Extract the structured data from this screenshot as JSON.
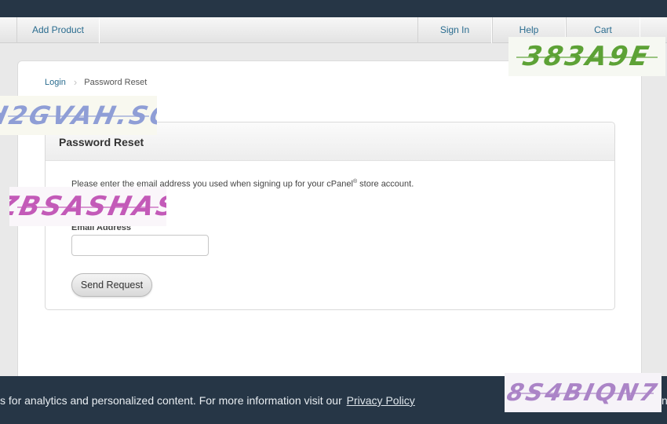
{
  "nav": {
    "items": [
      "Add Product",
      "Sign In",
      "Help",
      "Cart"
    ]
  },
  "breadcrumb": {
    "link": "Login",
    "current": "Password Reset"
  },
  "panel": {
    "title": "Password Reset",
    "intro_before": "Please enter the email address you used when signing up for your cPanel",
    "intro_sup": "®",
    "intro_after": " store account.",
    "email_label": "Email Address",
    "email_value": "",
    "submit_label": "Send Request"
  },
  "cookie": {
    "message": "s for analytics and personalized content. For more information visit our",
    "link": "Privacy Policy",
    "edge": "n"
  },
  "captchas": [
    "383A9E",
    "H2GVAH.SC",
    "ZBSASHAS",
    "8S4BIQN7"
  ],
  "colors": {
    "topbar": "#263646",
    "link": "#2a6c8f"
  }
}
